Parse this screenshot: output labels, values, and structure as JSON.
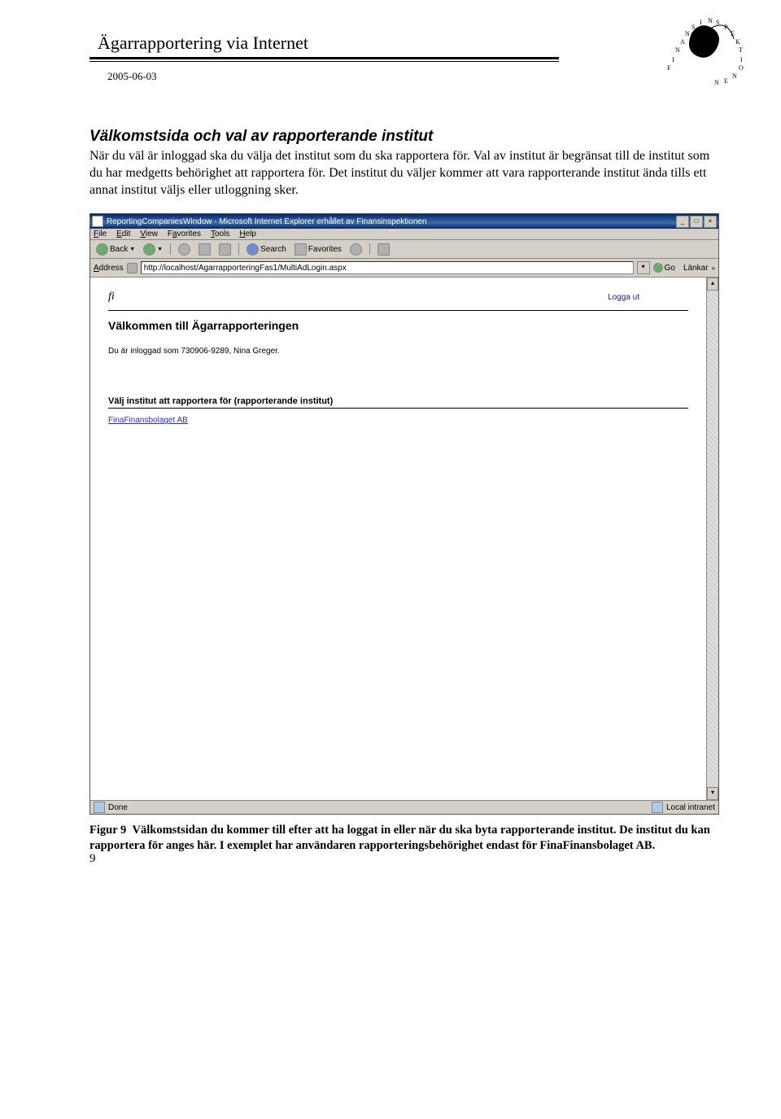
{
  "doc": {
    "title": "Ägarrapportering via Internet",
    "date": "2005-06-03",
    "page_number": "9"
  },
  "section": {
    "heading": "Välkomstsida och val av rapporterande institut",
    "paragraph": "När du väl är inloggad ska du välja det institut som du ska rapportera för. Val av institut är begränsat till de institut som du har medgetts behörighet att rapportera för. Det institut du väljer kommer att vara rapporterande institut ända tills ett annat institut väljs eller utloggning sker."
  },
  "caption": {
    "label": "Figur 9",
    "text": "Välkomstsidan du kommer till efter att ha loggat in eller när du ska byta rapporterande institut. De institut du kan rapportera för anges här. I exemplet har användaren rapporteringsbehörighet endast för FinaFinansbolaget AB."
  },
  "ie": {
    "title": "ReportingCompaniesWindow - Microsoft Internet Explorer erhållet av Finansinspektionen",
    "menus": {
      "file": "File",
      "edit": "Edit",
      "view": "View",
      "favorites": "Favorites",
      "tools": "Tools",
      "help": "Help"
    },
    "toolbar": {
      "back": "Back",
      "search": "Search",
      "favorites": "Favorites"
    },
    "address": {
      "label": "Address",
      "value": "http://localhost/AgarrapporteringFas1/MultiAdLogin.aspx",
      "go": "Go",
      "links": "Länkar"
    },
    "status": {
      "done": "Done",
      "zone": "Local intranet"
    }
  },
  "app": {
    "logout": "Logga ut",
    "title": "Välkommen till Ägarrapporteringen",
    "logged_in": "Du är inloggad som 730906-9289, Nina Greger.",
    "choose_heading": "Välj institut att rapportera för (rapporterande institut)",
    "company": "FinaFinansbolaget AB"
  }
}
